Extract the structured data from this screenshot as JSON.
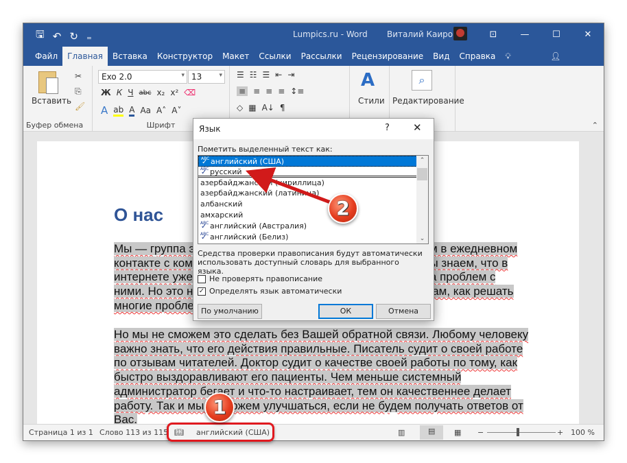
{
  "window": {
    "title": "Lumpics.ru - Word",
    "user_name": "Виталий Каиров",
    "controls": {
      "ribbon_display": "⊡",
      "minimize": "—",
      "maximize": "☐",
      "close": "✕"
    }
  },
  "quick_access": {
    "save_icon": "🖫",
    "undo_icon": "↶",
    "undo_dropdown": "▾",
    "redo_icon": "↻",
    "customize_icon": "₌"
  },
  "tabs": [
    {
      "label": "Файл",
      "active": false
    },
    {
      "label": "Главная",
      "active": true
    },
    {
      "label": "Вставка",
      "active": false
    },
    {
      "label": "Конструктор",
      "active": false
    },
    {
      "label": "Макет",
      "active": false
    },
    {
      "label": "Ссылки",
      "active": false
    },
    {
      "label": "Рассылки",
      "active": false
    },
    {
      "label": "Рецензирование",
      "active": false
    },
    {
      "label": "Вид",
      "active": false
    },
    {
      "label": "Справка",
      "active": false
    }
  ],
  "tab_extras": {
    "help_label": "Помощн",
    "share_label": "Поделиться"
  },
  "ribbon": {
    "clipboard": {
      "paste_label": "Вставить",
      "group_label": "Буфер обмена"
    },
    "font": {
      "font_name": "Exo 2.0",
      "font_size": "13",
      "bold": "Ж",
      "italic": "К",
      "underline": "Ч",
      "strike": "abc",
      "subscript": "x₂",
      "superscript": "x²",
      "text_effects": "A",
      "highlight": "ab",
      "font_color": "A",
      "change_case": "Aa",
      "grow": "A˄",
      "shrink": "A˅",
      "group_label": "Шрифт"
    },
    "paragraph": {
      "bullets": "☰",
      "numbering": "☷",
      "multilevel": "☰",
      "outdent": "⇤",
      "indent": "⇥",
      "align_left": "≡",
      "center": "≡",
      "align_right": "≡",
      "justify": "≡",
      "spacing": "↕≡",
      "shading": "◇",
      "borders": "▦",
      "sort": "A↓",
      "pilcrow": "¶"
    },
    "styles": {
      "label": "Стили"
    },
    "editing": {
      "label": "Редактирование"
    }
  },
  "document": {
    "heading": "О нас",
    "paragraph1": [
      "Мы — группа энтузиастов, одержимых идеей помогать Вам в ежедневном",
      "контакте с компьютерами и мобильными устройствами. Мы знаем, что в",
      "интернете уже полно информации о решении разного рода проблем с",
      "ними. Но это не останавливает нас, чтобы рассказывать Вам, как решать",
      "многие проблемы и задачи более качественно и быстрее."
    ],
    "paragraph2": [
      "Но мы не сможем это сделать без Вашей обратной связи. Любому человеку",
      "важно знать, что его действия правильные. Писатель судит о своей работе",
      "по отзывам читателей. Доктор судит о качестве своей работы по тому, как",
      "быстро выздоравливают его пациенты. Чем меньше системный",
      "администратор бегает и что-то настраивает, тем он качественнее делает",
      "работу. Так и мы не можем улучшаться, если не будем получать ответов от",
      "Вас."
    ]
  },
  "status_bar": {
    "page": "Страница 1 из 1",
    "words": "Слово 113 из 115",
    "language": "английский (США)",
    "zoom": "100 %",
    "zoom_minus": "−",
    "zoom_plus": "+",
    "zoom_level_percent": 100
  },
  "dialog": {
    "title": "Язык",
    "help": "?",
    "close": "✕",
    "prompt": "Пометить выделенный текст как:",
    "languages": [
      {
        "label": "английский (США)",
        "spellcheck": true,
        "selected": true
      },
      {
        "label": "русский",
        "spellcheck": true,
        "selected": false
      },
      {
        "label": "азербайджанский (кириллица)",
        "spellcheck": false,
        "selected": false
      },
      {
        "label": "азербайджанский (латиница)",
        "spellcheck": false,
        "selected": false
      },
      {
        "label": "албанский",
        "spellcheck": false,
        "selected": false
      },
      {
        "label": "амхарский",
        "spellcheck": false,
        "selected": false
      },
      {
        "label": "английский (Австралия)",
        "spellcheck": true,
        "selected": false
      },
      {
        "label": "английский (Белиз)",
        "spellcheck": true,
        "selected": false
      }
    ],
    "note": "Средства проверки правописания будут автоматически использовать доступный словарь для выбранного языка.",
    "no_spellcheck_label": "Не проверять правописание",
    "no_spellcheck_checked": false,
    "auto_detect_label": "Определять язык автоматически",
    "auto_detect_checked": true,
    "default_button": "По умолчанию",
    "ok_button": "ОК",
    "cancel_button": "Отмена"
  },
  "annotations": {
    "marker1": "1",
    "marker2": "2",
    "highlight_color": "#e0191f"
  }
}
